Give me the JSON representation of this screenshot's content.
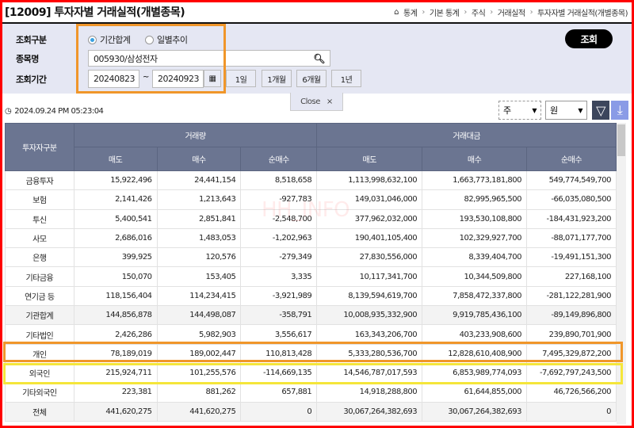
{
  "title": "[12009] 투자자별 거래실적(개별종목)",
  "breadcrumb": [
    "통계",
    "기본 통계",
    "주식",
    "거래실적",
    "투자자별 거래실적(개별종목)"
  ],
  "form": {
    "type_label": "조회구분",
    "type_options": [
      "기간합계",
      "일별추이"
    ],
    "type_selected": "기간합계",
    "item_label": "종목명",
    "item_value": "005930/삼성전자",
    "period_label": "조회기간",
    "start_date": "20240823",
    "tilde": "~",
    "end_date": "20240923",
    "quick": [
      "1일",
      "1개월",
      "6개월",
      "1년"
    ],
    "search_label": "조회",
    "close_label": "Close",
    "close_x": "×"
  },
  "timestamp": "2024.09.24 PM 05:23:04",
  "unit_select": "주",
  "currency_select": "원",
  "watermark": "HH_INFO",
  "colors": {
    "header": "#6b7591",
    "highlight_orange": "#f0962a",
    "highlight_yellow": "#f5e63a",
    "frame": "#ff0000"
  },
  "table": {
    "corner": "투자자구분",
    "group1": "거래량",
    "group2": "거래대금",
    "subcols": [
      "매도",
      "매수",
      "순매수",
      "매도",
      "매수",
      "순매수"
    ],
    "rows": [
      [
        "금융투자",
        "15,922,496",
        "24,441,154",
        "8,518,658",
        "1,113,998,632,100",
        "1,663,773,181,800",
        "549,774,549,700"
      ],
      [
        "보험",
        "2,141,426",
        "1,213,643",
        "-927,783",
        "149,031,046,000",
        "82,995,965,500",
        "-66,035,080,500"
      ],
      [
        "투신",
        "5,400,541",
        "2,851,841",
        "-2,548,700",
        "377,962,032,000",
        "193,530,108,800",
        "-184,431,923,200"
      ],
      [
        "사모",
        "2,686,016",
        "1,483,053",
        "-1,202,963",
        "190,401,105,400",
        "102,329,927,700",
        "-88,071,177,700"
      ],
      [
        "은행",
        "399,925",
        "120,576",
        "-279,349",
        "27,830,556,000",
        "8,339,404,700",
        "-19,491,151,300"
      ],
      [
        "기타금융",
        "150,070",
        "153,405",
        "3,335",
        "10,117,341,700",
        "10,344,509,800",
        "227,168,100"
      ],
      [
        "연기금 등",
        "118,156,404",
        "114,234,415",
        "-3,921,989",
        "8,139,594,619,700",
        "7,858,472,337,800",
        "-281,122,281,900"
      ],
      [
        "기관합계",
        "144,856,878",
        "144,498,087",
        "-358,791",
        "10,008,935,332,900",
        "9,919,785,436,100",
        "-89,149,896,800"
      ],
      [
        "기타법인",
        "2,426,286",
        "5,982,903",
        "3,556,617",
        "163,343,206,700",
        "403,233,908,600",
        "239,890,701,900"
      ],
      [
        "개인",
        "78,189,019",
        "189,002,447",
        "110,813,428",
        "5,333,280,536,700",
        "12,828,610,408,900",
        "7,495,329,872,200"
      ],
      [
        "외국인",
        "215,924,711",
        "101,255,576",
        "-114,669,135",
        "14,546,787,017,593",
        "6,853,989,774,093",
        "-7,692,797,243,500"
      ],
      [
        "기타외국인",
        "223,381",
        "881,262",
        "657,881",
        "14,918,288,800",
        "61,644,855,000",
        "46,726,566,200"
      ],
      [
        "전체",
        "441,620,275",
        "441,620,275",
        "0",
        "30,067,264,382,693",
        "30,067,264,382,693",
        "0"
      ]
    ]
  }
}
